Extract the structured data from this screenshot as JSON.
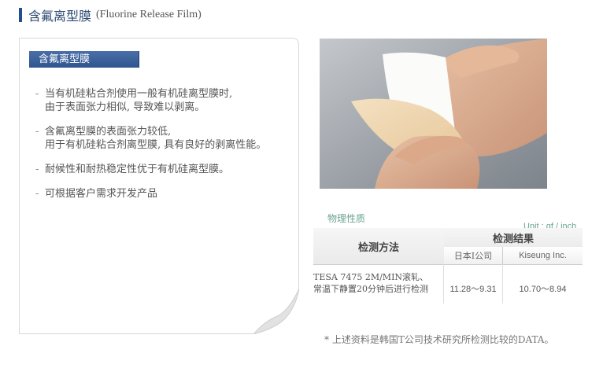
{
  "header": {
    "title": "含氟离型膜",
    "subtitle": "(Fluorine Release Film)"
  },
  "card": {
    "tab_label": "含氟离型膜",
    "bullets": [
      "当有机硅粘合剂使用一般有机硅离型膜时,\n由于表面张力相似, 导致难以剥离。",
      "含氟离型膜的表面张力较低,\n用于有机硅粘合剂离型膜, 具有良好的剥离性能。",
      "耐候性和耐热稳定性优于有机硅离型膜。",
      "可根据客户需求开发产品"
    ],
    "bullet_mark": "-"
  },
  "properties": {
    "label": "物理性质",
    "unit": "Unit : gf / inch",
    "table": {
      "method_header": "检测方法",
      "results_header": "检测结果",
      "columns": [
        "日本I公司",
        "Kiseung Inc."
      ],
      "rows": [
        {
          "method": "TESA 7475 2M/MIN滚轧、\n常温下静置20分钟后进行检测",
          "values": [
            "11.28～9.31",
            "10.70～8.94"
          ]
        }
      ]
    }
  },
  "footnote": "* 上述资料是韩国T公司技术研究所检测比较的DATA。",
  "colors": {
    "accent": "#2f5590",
    "green_label": "#6aa38f"
  }
}
